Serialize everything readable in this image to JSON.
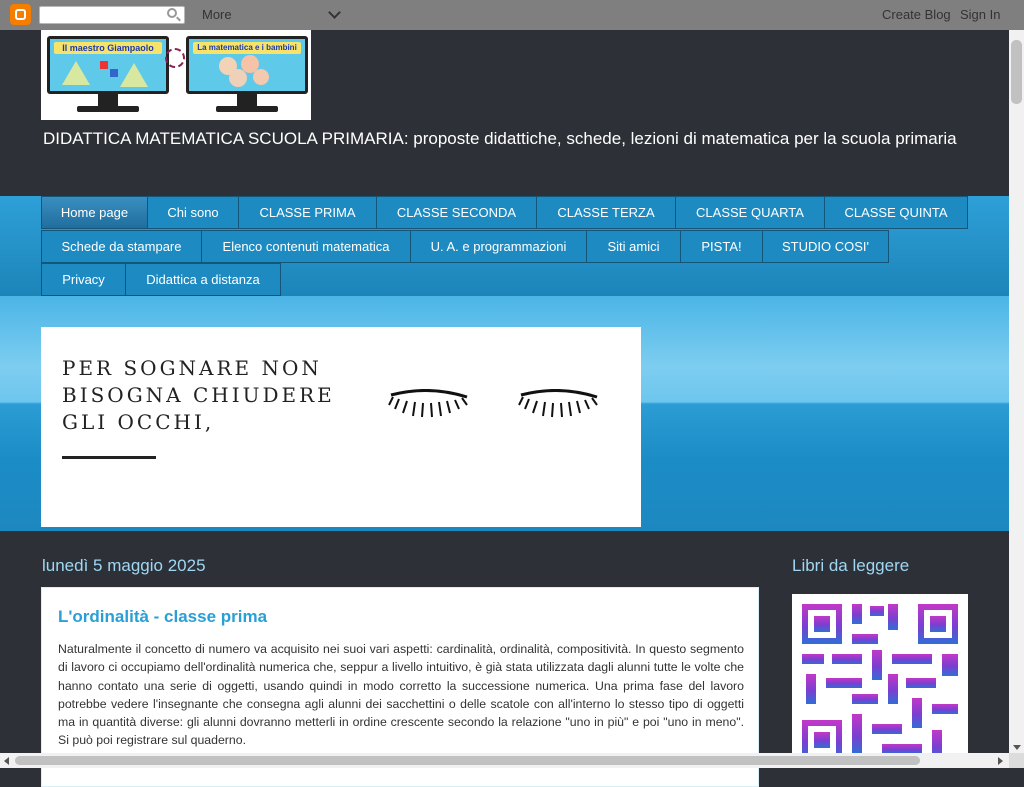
{
  "navbar": {
    "more_label": "More",
    "create_blog": "Create Blog",
    "sign_in": "Sign In"
  },
  "header": {
    "logo_left_text": "Il maestro Giampaolo",
    "logo_right_text": "La matematica e i bambini",
    "description": "DIDATTICA MATEMATICA SCUOLA PRIMARIA: proposte didattiche, schede, lezioni di matematica per la scuola primaria"
  },
  "tabs": [
    {
      "label": "Home page",
      "active": true
    },
    {
      "label": "Chi sono"
    },
    {
      "label": "CLASSE PRIMA"
    },
    {
      "label": "CLASSE SECONDA"
    },
    {
      "label": "CLASSE TERZA"
    },
    {
      "label": "CLASSE QUARTA"
    },
    {
      "label": "CLASSE QUINTA"
    },
    {
      "label": "Schede da stampare"
    },
    {
      "label": "Elenco contenuti matematica"
    },
    {
      "label": "U. A. e programmazioni"
    },
    {
      "label": "Siti amici"
    },
    {
      "label": "PISTA!"
    },
    {
      "label": "STUDIO COSI'"
    },
    {
      "label": "Privacy"
    },
    {
      "label": "Didattica a distanza"
    }
  ],
  "banner": {
    "text": "PER SOGNARE NON\nBISOGNA CHIUDERE\nGLI OCCHI,"
  },
  "main": {
    "date": "lunedì 5 maggio 2025",
    "post_title": "L'ordinalità - classe prima",
    "post_body": "Naturalmente il concetto di numero va acquisito nei suoi vari aspetti: cardinalità, ordinalità, compositività. In questo segmento di lavoro ci occupiamo dell'ordinalità numerica che, seppur a livello intuitivo, è già stata utilizzata dagli alunni tutte le volte che hanno contato una serie di oggetti, usando quindi in modo corretto la successione numerica. Una prima fase del lavoro potrebbe vedere l'insegnante che consegna agli alunni dei sacchettini o delle scatole con all'interno lo stesso tipo di oggetti ma in quantità diverse: gli alunni dovranno metterli in ordine crescente secondo la relazione \"uno in più\" e poi \"uno in meno\". Si può poi registrare sul quaderno."
  },
  "sidebar": {
    "title": "Libri da leggere"
  },
  "colors": {
    "page_bg": "#2d3037",
    "tab_blue": "#1d8bc2",
    "title_blue": "#2a9fd6",
    "date_blue": "#9fd7f3"
  }
}
